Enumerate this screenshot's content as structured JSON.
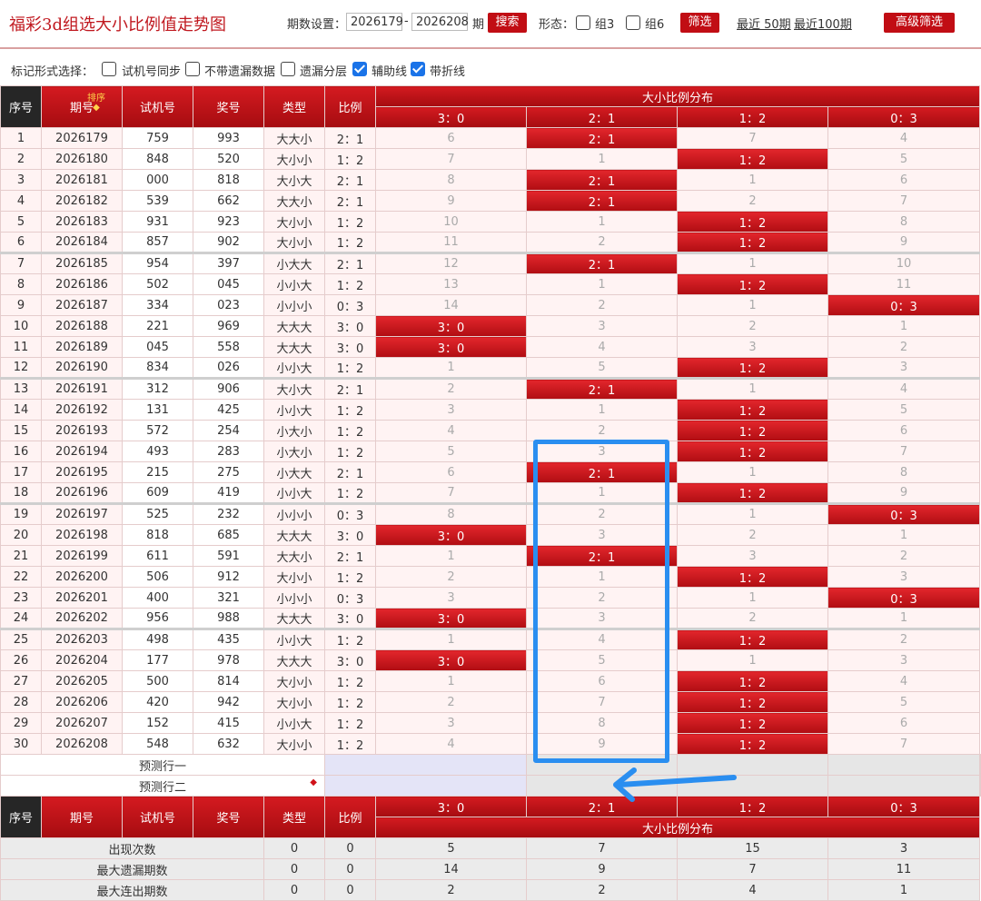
{
  "header": {
    "title": "福彩3d组选大小比例值走势图",
    "period_label": "期数设置：",
    "period_from": "2026179",
    "period_dash": "-",
    "period_to": "2026208",
    "period_suffix": "期",
    "search_btn": "搜索",
    "shape_label": "形态：",
    "zu3": "组3",
    "zu6": "组6",
    "filter_btn": "筛选",
    "recent50": "最近 50期",
    "recent100": "最近100期",
    "advanced_btn": "高级筛选"
  },
  "markbar": {
    "label": "标记形式选择：",
    "opt1": "试机号同步",
    "opt2": "不带遗漏数据",
    "opt3": "遗漏分层",
    "opt4": "辅助线",
    "opt5": "带折线"
  },
  "columns": {
    "seq": "序号",
    "period": "期号",
    "sort": "排序",
    "sort_arrow": "◆",
    "trial": "试机号",
    "prize": "奖号",
    "type": "类型",
    "ratio": "比例",
    "dist": "大小比例分布",
    "r30": "3：0",
    "r21": "2：1",
    "r12": "1：2",
    "r03": "0：3"
  },
  "rows": [
    {
      "seq": "1",
      "period": "2026179",
      "trial": "759",
      "prize": "993",
      "type": "大大小",
      "ratio": "2：1",
      "d": [
        "6",
        "2：1",
        "7",
        "4"
      ],
      "hit": 1
    },
    {
      "seq": "2",
      "period": "2026180",
      "trial": "848",
      "prize": "520",
      "type": "大小小",
      "ratio": "1：2",
      "d": [
        "7",
        "1",
        "1：2",
        "5"
      ],
      "hit": 2
    },
    {
      "seq": "3",
      "period": "2026181",
      "trial": "000",
      "prize": "818",
      "type": "大小大",
      "ratio": "2：1",
      "d": [
        "8",
        "2：1",
        "1",
        "6"
      ],
      "hit": 1
    },
    {
      "seq": "4",
      "period": "2026182",
      "trial": "539",
      "prize": "662",
      "type": "大大小",
      "ratio": "2：1",
      "d": [
        "9",
        "2：1",
        "2",
        "7"
      ],
      "hit": 1
    },
    {
      "seq": "5",
      "period": "2026183",
      "trial": "931",
      "prize": "923",
      "type": "大小小",
      "ratio": "1：2",
      "d": [
        "10",
        "1",
        "1：2",
        "8"
      ],
      "hit": 2
    },
    {
      "seq": "6",
      "period": "2026184",
      "trial": "857",
      "prize": "902",
      "type": "大小小",
      "ratio": "1：2",
      "d": [
        "11",
        "2",
        "1：2",
        "9"
      ],
      "hit": 2
    },
    {
      "seq": "7",
      "period": "2026185",
      "trial": "954",
      "prize": "397",
      "type": "小大大",
      "ratio": "2：1",
      "d": [
        "12",
        "2：1",
        "1",
        "10"
      ],
      "hit": 1
    },
    {
      "seq": "8",
      "period": "2026186",
      "trial": "502",
      "prize": "045",
      "type": "小小大",
      "ratio": "1：2",
      "d": [
        "13",
        "1",
        "1：2",
        "11"
      ],
      "hit": 2
    },
    {
      "seq": "9",
      "period": "2026187",
      "trial": "334",
      "prize": "023",
      "type": "小小小",
      "ratio": "0：3",
      "d": [
        "14",
        "2",
        "1",
        "0：3"
      ],
      "hit": 3
    },
    {
      "seq": "10",
      "period": "2026188",
      "trial": "221",
      "prize": "969",
      "type": "大大大",
      "ratio": "3：0",
      "d": [
        "3：0",
        "3",
        "2",
        "1"
      ],
      "hit": 0
    },
    {
      "seq": "11",
      "period": "2026189",
      "trial": "045",
      "prize": "558",
      "type": "大大大",
      "ratio": "3：0",
      "d": [
        "3：0",
        "4",
        "3",
        "2"
      ],
      "hit": 0
    },
    {
      "seq": "12",
      "period": "2026190",
      "trial": "834",
      "prize": "026",
      "type": "小小大",
      "ratio": "1：2",
      "d": [
        "1",
        "5",
        "1：2",
        "3"
      ],
      "hit": 2
    },
    {
      "seq": "13",
      "period": "2026191",
      "trial": "312",
      "prize": "906",
      "type": "大小大",
      "ratio": "2：1",
      "d": [
        "2",
        "2：1",
        "1",
        "4"
      ],
      "hit": 1
    },
    {
      "seq": "14",
      "period": "2026192",
      "trial": "131",
      "prize": "425",
      "type": "小小大",
      "ratio": "1：2",
      "d": [
        "3",
        "1",
        "1：2",
        "5"
      ],
      "hit": 2
    },
    {
      "seq": "15",
      "period": "2026193",
      "trial": "572",
      "prize": "254",
      "type": "小大小",
      "ratio": "1：2",
      "d": [
        "4",
        "2",
        "1：2",
        "6"
      ],
      "hit": 2
    },
    {
      "seq": "16",
      "period": "2026194",
      "trial": "493",
      "prize": "283",
      "type": "小大小",
      "ratio": "1：2",
      "d": [
        "5",
        "3",
        "1：2",
        "7"
      ],
      "hit": 2
    },
    {
      "seq": "17",
      "period": "2026195",
      "trial": "215",
      "prize": "275",
      "type": "小大大",
      "ratio": "2：1",
      "d": [
        "6",
        "2：1",
        "1",
        "8"
      ],
      "hit": 1
    },
    {
      "seq": "18",
      "period": "2026196",
      "trial": "609",
      "prize": "419",
      "type": "小小大",
      "ratio": "1：2",
      "d": [
        "7",
        "1",
        "1：2",
        "9"
      ],
      "hit": 2
    },
    {
      "seq": "19",
      "period": "2026197",
      "trial": "525",
      "prize": "232",
      "type": "小小小",
      "ratio": "0：3",
      "d": [
        "8",
        "2",
        "1",
        "0：3"
      ],
      "hit": 3
    },
    {
      "seq": "20",
      "period": "2026198",
      "trial": "818",
      "prize": "685",
      "type": "大大大",
      "ratio": "3：0",
      "d": [
        "3：0",
        "3",
        "2",
        "1"
      ],
      "hit": 0
    },
    {
      "seq": "21",
      "period": "2026199",
      "trial": "611",
      "prize": "591",
      "type": "大大小",
      "ratio": "2：1",
      "d": [
        "1",
        "2：1",
        "3",
        "2"
      ],
      "hit": 1
    },
    {
      "seq": "22",
      "period": "2026200",
      "trial": "506",
      "prize": "912",
      "type": "大小小",
      "ratio": "1：2",
      "d": [
        "2",
        "1",
        "1：2",
        "3"
      ],
      "hit": 2
    },
    {
      "seq": "23",
      "period": "2026201",
      "trial": "400",
      "prize": "321",
      "type": "小小小",
      "ratio": "0：3",
      "d": [
        "3",
        "2",
        "1",
        "0：3"
      ],
      "hit": 3
    },
    {
      "seq": "24",
      "period": "2026202",
      "trial": "956",
      "prize": "988",
      "type": "大大大",
      "ratio": "3：0",
      "d": [
        "3：0",
        "3",
        "2",
        "1"
      ],
      "hit": 0
    },
    {
      "seq": "25",
      "period": "2026203",
      "trial": "498",
      "prize": "435",
      "type": "小小大",
      "ratio": "1：2",
      "d": [
        "1",
        "4",
        "1：2",
        "2"
      ],
      "hit": 2
    },
    {
      "seq": "26",
      "period": "2026204",
      "trial": "177",
      "prize": "978",
      "type": "大大大",
      "ratio": "3：0",
      "d": [
        "3：0",
        "5",
        "1",
        "3"
      ],
      "hit": 0
    },
    {
      "seq": "27",
      "period": "2026205",
      "trial": "500",
      "prize": "814",
      "type": "大小小",
      "ratio": "1：2",
      "d": [
        "1",
        "6",
        "1：2",
        "4"
      ],
      "hit": 2
    },
    {
      "seq": "28",
      "period": "2026206",
      "trial": "420",
      "prize": "942",
      "type": "大小小",
      "ratio": "1：2",
      "d": [
        "2",
        "7",
        "1：2",
        "5"
      ],
      "hit": 2
    },
    {
      "seq": "29",
      "period": "2026207",
      "trial": "152",
      "prize": "415",
      "type": "小小大",
      "ratio": "1：2",
      "d": [
        "3",
        "8",
        "1：2",
        "6"
      ],
      "hit": 2
    },
    {
      "seq": "30",
      "period": "2026208",
      "trial": "548",
      "prize": "632",
      "type": "大小小",
      "ratio": "1：2",
      "d": [
        "4",
        "9",
        "1：2",
        "7"
      ],
      "hit": 2
    }
  ],
  "predict": {
    "row1": "预测行一",
    "row2": "预测行二",
    "row2_arrow": "◆"
  },
  "stats": [
    {
      "label": "出现次数",
      "type": "0",
      "ratio": "0",
      "d": [
        "5",
        "7",
        "15",
        "3"
      ]
    },
    {
      "label": "最大遗漏期数",
      "type": "0",
      "ratio": "0",
      "d": [
        "14",
        "9",
        "7",
        "11"
      ]
    },
    {
      "label": "最大连出期数",
      "type": "0",
      "ratio": "0",
      "d": [
        "2",
        "2",
        "4",
        "1"
      ]
    }
  ],
  "colors": {
    "accent": "#c10d14",
    "annotation": "#2a8ef0"
  }
}
